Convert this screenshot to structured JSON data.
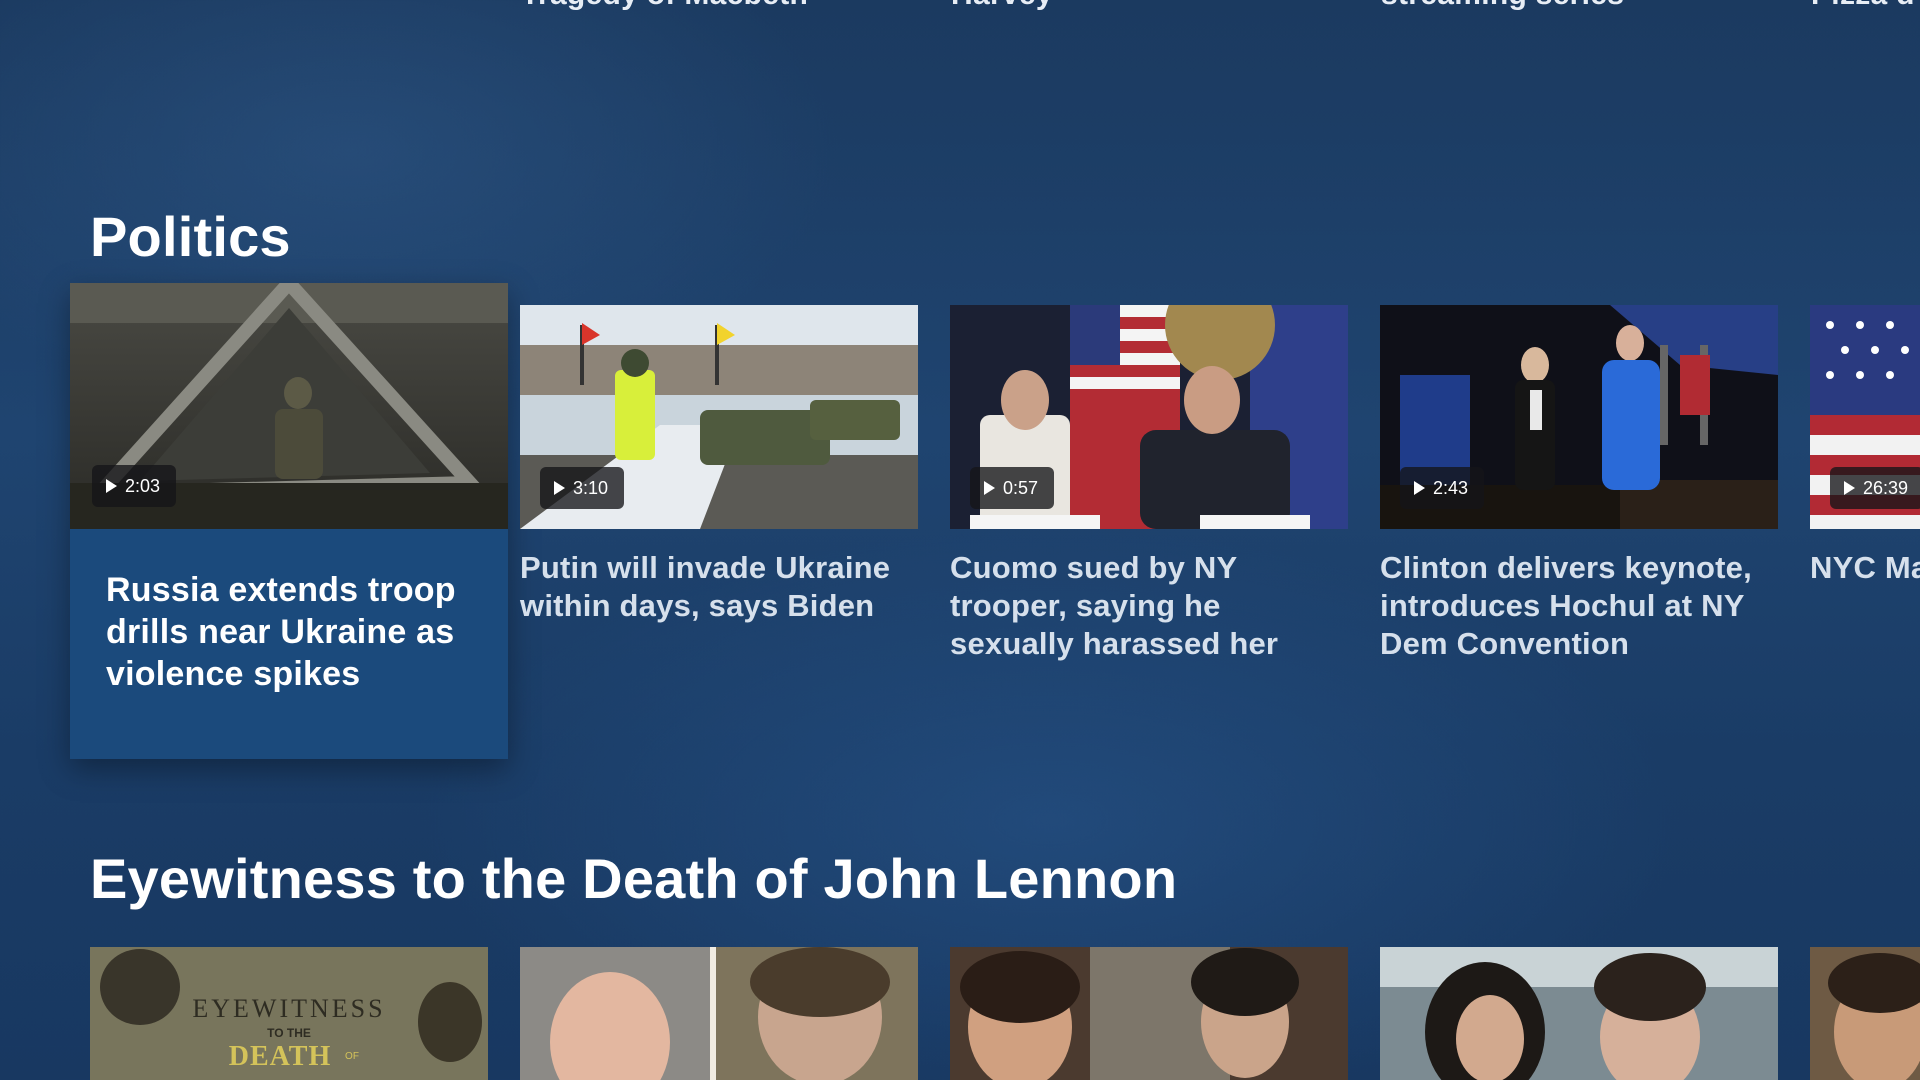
{
  "top_row": {
    "titles": [
      "Tragedy of Macbeth",
      "Harvey",
      "streaming series",
      "Pizza d"
    ]
  },
  "politics": {
    "title": "Politics",
    "cards": [
      {
        "duration": "2:03",
        "title": "Russia extends troop drills near Ukraine as violence spikes"
      },
      {
        "duration": "3:10",
        "title": "Putin will invade Ukraine within days, says Biden"
      },
      {
        "duration": "0:57",
        "title": "Cuomo sued by NY trooper, saying he sexually harassed her"
      },
      {
        "duration": "2:43",
        "title": "Clinton delivers keynote, introduces Hochul at NY Dem Convention"
      },
      {
        "duration": "26:39",
        "title": "NYC Ma out firs adminis"
      }
    ]
  },
  "lennon": {
    "title": "Eyewitness to the Death of John Lennon",
    "logo": {
      "line1": "EYEWITNESS",
      "line2": "TO THE",
      "line3": "DEATH",
      "line4": "OF"
    }
  },
  "colors": {
    "background": "#1d406b",
    "focused_card": "#1b4a7c",
    "text_primary": "#ffffff",
    "text_secondary": "#d6e0ec"
  }
}
